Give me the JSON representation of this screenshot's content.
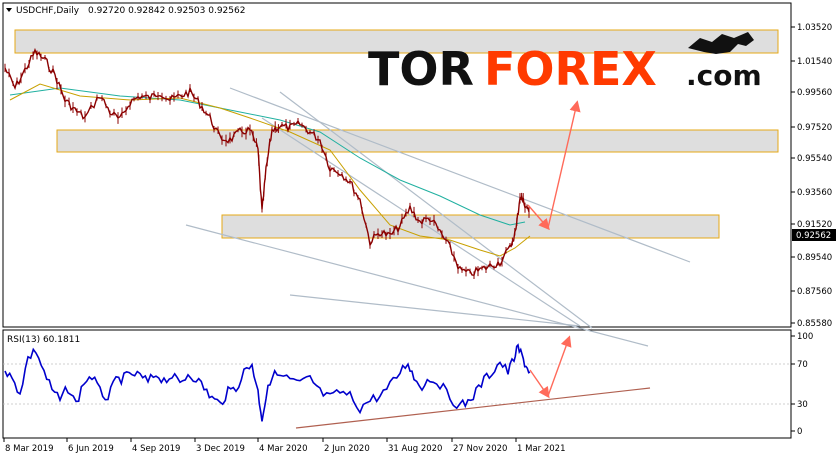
{
  "header": {
    "symbol": "USDCHF,Daily",
    "ohlc": "0.92720 0.92842 0.92503 0.92562"
  },
  "logo": {
    "part1": "TOR",
    "part2": "FOREX",
    "part3": ".com",
    "color_dark": "#111111",
    "color_accent": "#ff3a00"
  },
  "price_axis": {
    "ticks": [
      "1.03520",
      "1.01540",
      "0.99560",
      "0.97520",
      "0.95540",
      "0.93560",
      "0.91520",
      "0.89540",
      "0.87560",
      "0.85580"
    ],
    "current": "0.92562"
  },
  "rsi": {
    "label": "RSI(13) 60.1811",
    "ticks": [
      "100",
      "70",
      "30",
      "0"
    ]
  },
  "date_axis": {
    "labels": [
      "8 Mar 2019",
      "6 Jun 2019",
      "4 Sep 2019",
      "3 Dec 2019",
      "4 Mar 2020",
      "2 Jun 2020",
      "31 Aug 2020",
      "27 Nov 2020",
      "1 Mar 2021"
    ]
  },
  "colors": {
    "candles": "#8b0000",
    "ma_fast": "#c8a000",
    "ma_slow": "#20b0a0",
    "zone_border": "#e6a817",
    "zone_fill": "#d8d8d8",
    "channel": "#b0bcc8",
    "arrow": "#ff6a5a",
    "rsi_line": "#0000cc",
    "rsi_trend": "#b06050"
  }
}
